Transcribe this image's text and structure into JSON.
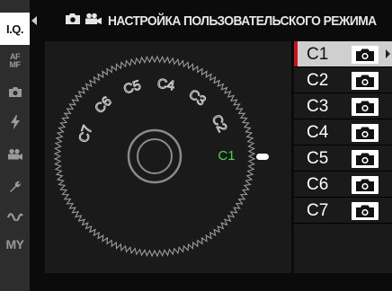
{
  "header": {
    "title": "НАСТРОЙКА ПОЛЬЗОВАТЕЛЬСКОГО РЕЖИМА"
  },
  "sidebar": {
    "items": [
      {
        "label": "I.Q.",
        "icon": "image-quality-icon",
        "active": true
      },
      {
        "label": "AF MF",
        "icon": "focus-icon",
        "active": false
      },
      {
        "label": "",
        "icon": "camera-icon",
        "active": false
      },
      {
        "label": "",
        "icon": "flash-icon",
        "active": false
      },
      {
        "label": "",
        "icon": "movie-icon",
        "active": false
      },
      {
        "label": "",
        "icon": "wrench-icon",
        "active": false
      },
      {
        "label": "",
        "icon": "connection-icon",
        "active": false
      },
      {
        "label": "MY",
        "icon": "my-menu-icon",
        "active": false
      }
    ]
  },
  "dial": {
    "positions": [
      "C1",
      "C2",
      "C3",
      "C4",
      "C5",
      "C6",
      "C7"
    ],
    "selected": "C1",
    "colors": {
      "selected_label": "#4cd64c",
      "label": "#cfcfcf"
    }
  },
  "modes": [
    {
      "name": "C1",
      "type": "camera-icon",
      "selected": true
    },
    {
      "name": "C2",
      "type": "camera-icon",
      "selected": false
    },
    {
      "name": "C3",
      "type": "camera-icon",
      "selected": false
    },
    {
      "name": "C4",
      "type": "camera-icon",
      "selected": false
    },
    {
      "name": "C5",
      "type": "camera-icon",
      "selected": false
    },
    {
      "name": "C6",
      "type": "camera-icon",
      "selected": false
    },
    {
      "name": "C7",
      "type": "camera-icon",
      "selected": false
    }
  ],
  "colors": {
    "accent": "#c4161c",
    "selected_row": "#cfcfcf",
    "panel": "#1a1a1a"
  }
}
